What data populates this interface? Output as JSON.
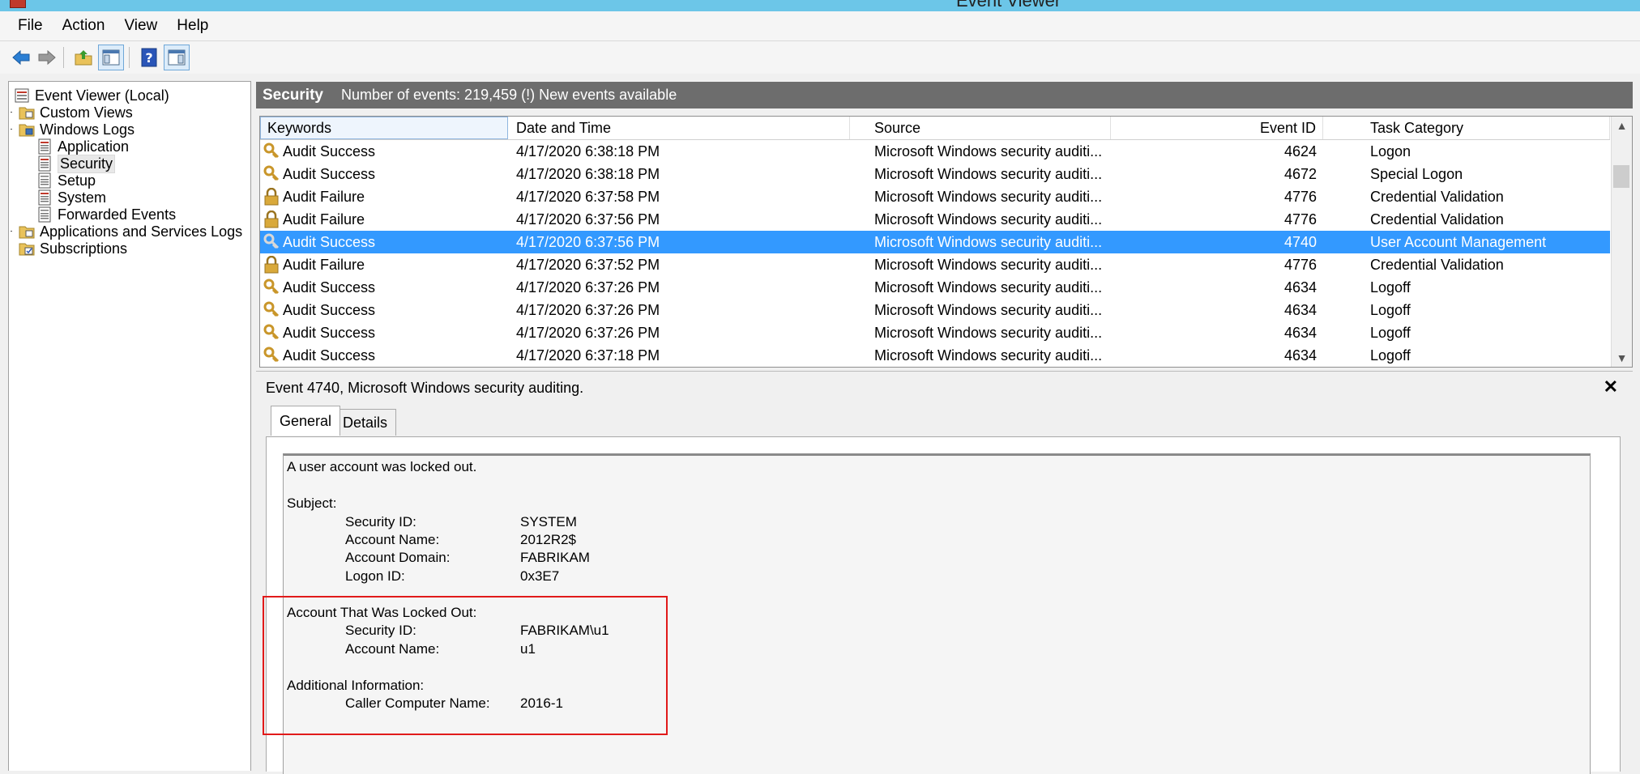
{
  "window": {
    "title": "Event Viewer"
  },
  "menu": [
    "File",
    "Action",
    "View",
    "Help"
  ],
  "toolbar": {
    "icons": [
      "back-arrow-icon",
      "forward-arrow-icon",
      "up-folder-icon",
      "show-hide-console-tree-icon",
      "help-icon",
      "show-hide-action-pane-icon"
    ]
  },
  "tree": {
    "root": "Event Viewer (Local)",
    "custom_views": "Custom Views",
    "windows_logs": "Windows Logs",
    "logs": [
      "Application",
      "Security",
      "Setup",
      "System",
      "Forwarded Events"
    ],
    "apps_services": "Applications and Services Logs",
    "subscriptions": "Subscriptions"
  },
  "pane": {
    "title": "Security",
    "count": "Number of events: 219,459 (!) New events available"
  },
  "grid": {
    "columns": [
      "Keywords",
      "Date and Time",
      "Source",
      "Event ID",
      "Task Category"
    ],
    "rows": [
      {
        "keyword": "Audit Success",
        "date": "4/17/2020 6:38:18 PM",
        "source": "Microsoft Windows security auditi...",
        "id": "4624",
        "category": "Logon"
      },
      {
        "keyword": "Audit Success",
        "date": "4/17/2020 6:38:18 PM",
        "source": "Microsoft Windows security auditi...",
        "id": "4672",
        "category": "Special Logon"
      },
      {
        "keyword": "Audit Failure",
        "date": "4/17/2020 6:37:58 PM",
        "source": "Microsoft Windows security auditi...",
        "id": "4776",
        "category": "Credential Validation"
      },
      {
        "keyword": "Audit Failure",
        "date": "4/17/2020 6:37:56 PM",
        "source": "Microsoft Windows security auditi...",
        "id": "4776",
        "category": "Credential Validation"
      },
      {
        "keyword": "Audit Success",
        "date": "4/17/2020 6:37:56 PM",
        "source": "Microsoft Windows security auditi...",
        "id": "4740",
        "category": "User Account Management"
      },
      {
        "keyword": "Audit Failure",
        "date": "4/17/2020 6:37:52 PM",
        "source": "Microsoft Windows security auditi...",
        "id": "4776",
        "category": "Credential Validation"
      },
      {
        "keyword": "Audit Success",
        "date": "4/17/2020 6:37:26 PM",
        "source": "Microsoft Windows security auditi...",
        "id": "4634",
        "category": "Logoff"
      },
      {
        "keyword": "Audit Success",
        "date": "4/17/2020 6:37:26 PM",
        "source": "Microsoft Windows security auditi...",
        "id": "4634",
        "category": "Logoff"
      },
      {
        "keyword": "Audit Success",
        "date": "4/17/2020 6:37:26 PM",
        "source": "Microsoft Windows security auditi...",
        "id": "4634",
        "category": "Logoff"
      },
      {
        "keyword": "Audit Success",
        "date": "4/17/2020 6:37:18 PM",
        "source": "Microsoft Windows security auditi...",
        "id": "4634",
        "category": "Logoff"
      }
    ],
    "selected_row": 4
  },
  "detail": {
    "title": "Event 4740, Microsoft Windows security auditing.",
    "tabs": [
      "General",
      "Details"
    ],
    "message": {
      "summary": "A user account was locked out.",
      "subject_header": "Subject:",
      "subject": [
        {
          "label": "Security ID:",
          "value": "SYSTEM"
        },
        {
          "label": "Account Name:",
          "value": "2012R2$"
        },
        {
          "label": "Account Domain:",
          "value": "FABRIKAM"
        },
        {
          "label": "Logon ID:",
          "value": "0x3E7"
        }
      ],
      "locked_header": "Account That Was Locked Out:",
      "locked": [
        {
          "label": "Security ID:",
          "value": "FABRIKAM\\u1"
        },
        {
          "label": "Account Name:",
          "value": "u1"
        }
      ],
      "additional_header": "Additional Information:",
      "additional": [
        {
          "label": "Caller Computer Name:",
          "value": "2016-1"
        }
      ]
    }
  },
  "colors": {
    "selection": "#3399ff",
    "pane_header": "#6d6d6d",
    "highlight_box": "#e11a1a",
    "titlebar": "#6cc6e8"
  }
}
